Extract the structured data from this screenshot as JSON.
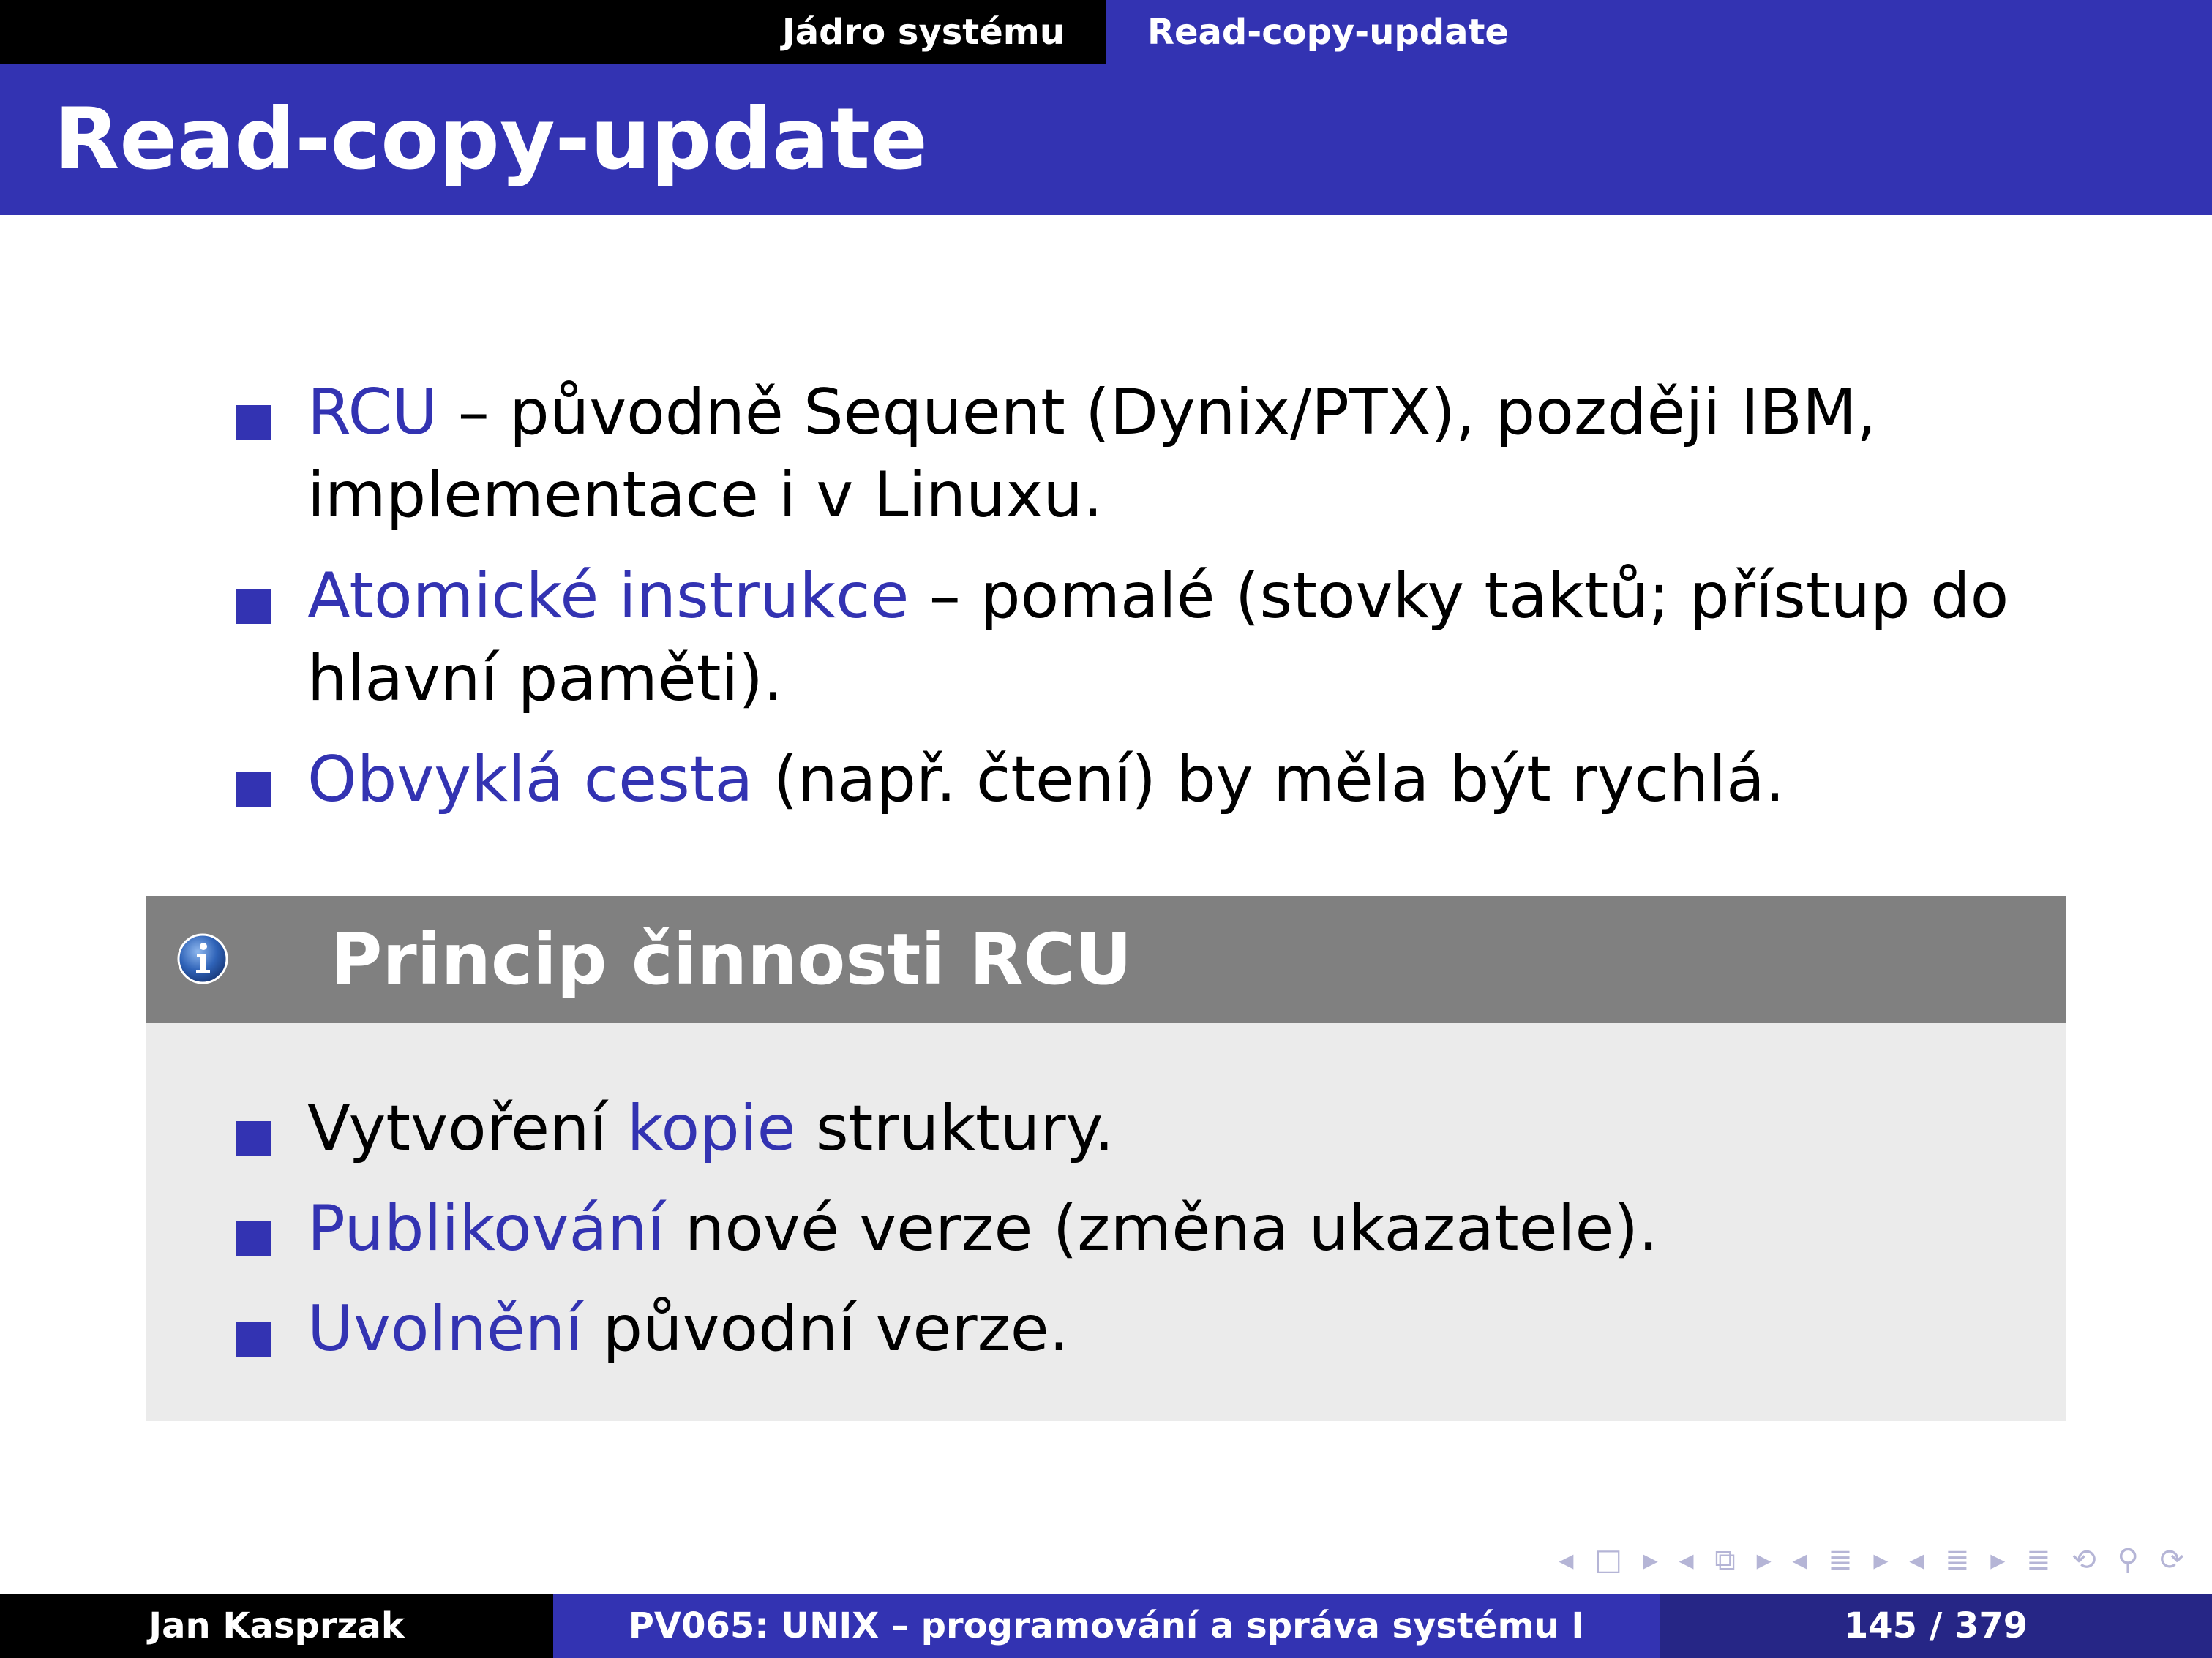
{
  "header": {
    "section": "Jádro systému",
    "subsection": "Read-copy-update"
  },
  "frame": {
    "title": "Read-copy-update"
  },
  "bullets": [
    {
      "highlight": "RCU",
      "rest": " – původně Sequent (Dynix/PTX), později IBM, implementace i v Linuxu."
    },
    {
      "highlight": "Atomické instrukce",
      "rest": " – pomalé (stovky taktů; přístup do hlavní paměti)."
    },
    {
      "highlight": "Obvyklá cesta",
      "rest": " (např. čtení) by měla být rychlá."
    }
  ],
  "block": {
    "title": "Princip činnosti RCU",
    "icon": "info-icon",
    "items": [
      {
        "before": "Vytvoření ",
        "highlight": "kopie",
        "after": " struktury."
      },
      {
        "before": "",
        "highlight": "Publikování",
        "after": " nové verze (změna ukazatele)."
      },
      {
        "before": "",
        "highlight": "Uvolnění",
        "after": " původní verze."
      }
    ]
  },
  "navigation": {
    "symbols": "◂ □ ▸ ◂ ⧉ ▸ ◂ ≣ ▸ ◂ ≣ ▸   ≣   ⟲ ⚲ ⟳"
  },
  "footer": {
    "author": "Jan Kasprzak",
    "course": "PV065: UNIX – programování a správa systému I",
    "page": "145 / 379"
  },
  "colors": {
    "accent": "#3333b2",
    "block_head": "#808080",
    "block_body": "#ebebeb",
    "footer_page_bg": "#262686"
  }
}
